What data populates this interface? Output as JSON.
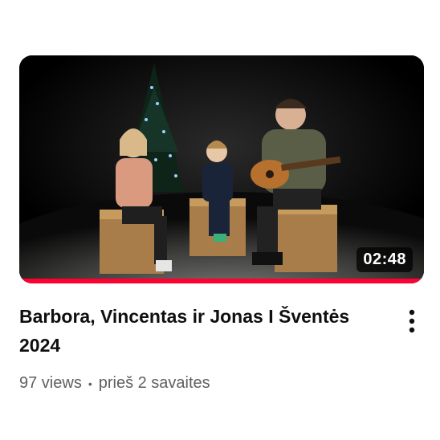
{
  "video": {
    "title": "Barbora, Vincentas ir Jonas I Šventės 2024",
    "duration": "02:48",
    "views": "97 views",
    "separator": "•",
    "published": "prieš 2 savaites",
    "watch_progress": 1.0,
    "thumbnail_description_icon": "video-thumbnail",
    "menu_icon": "more-vertical-icon"
  },
  "colors": {
    "progress": "#ff0033",
    "title": "#0f0f0f",
    "meta": "#606060"
  }
}
